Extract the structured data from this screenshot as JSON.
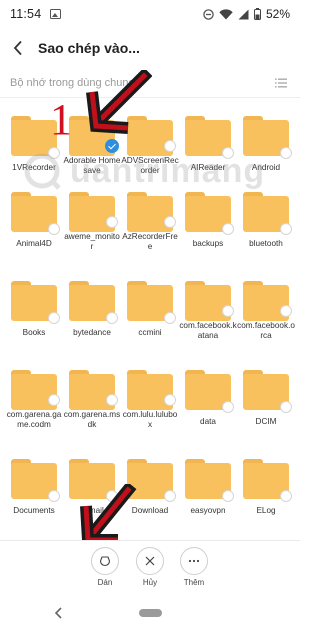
{
  "status_bar": {
    "time": "11:54",
    "battery": "52%"
  },
  "app_bar": {
    "title": "Sao chép vào..."
  },
  "path_bar": {
    "path": "Bộ nhớ trong dùng chung"
  },
  "folders": [
    {
      "name": "1VRecorder",
      "checked": false
    },
    {
      "name": "Adorable Home save",
      "checked": true
    },
    {
      "name": "ADVScreenRecorder",
      "checked": false
    },
    {
      "name": "AIReader",
      "checked": false
    },
    {
      "name": "Android",
      "checked": false
    },
    {
      "name": "Animal4D",
      "checked": false
    },
    {
      "name": "aweme_monitor",
      "checked": false
    },
    {
      "name": "AzRecorderFree",
      "checked": false
    },
    {
      "name": "backups",
      "checked": false
    },
    {
      "name": "bluetooth",
      "checked": false
    },
    {
      "name": "Books",
      "checked": false
    },
    {
      "name": "bytedance",
      "checked": false
    },
    {
      "name": "ccmini",
      "checked": false
    },
    {
      "name": "com.facebook.katana",
      "checked": false
    },
    {
      "name": "com.facebook.orca",
      "checked": false
    },
    {
      "name": "com.garena.game.codm",
      "checked": false
    },
    {
      "name": "com.garena.msdk",
      "checked": false
    },
    {
      "name": "com.lulu.lulubox",
      "checked": false
    },
    {
      "name": "data",
      "checked": false
    },
    {
      "name": "DCIM",
      "checked": false
    },
    {
      "name": "Documents",
      "checked": false
    },
    {
      "name": "dcmail",
      "checked": false
    },
    {
      "name": "Download",
      "checked": false
    },
    {
      "name": "easyovpn",
      "checked": false
    },
    {
      "name": "ELog",
      "checked": false
    }
  ],
  "annotations": {
    "step1": "1",
    "step2": "2",
    "color": "#d01020"
  },
  "watermark": {
    "text": "uantrimang"
  },
  "bottom_actions": [
    {
      "label": "Dán",
      "icon": "paste-icon"
    },
    {
      "label": "Hủy",
      "icon": "close-icon"
    },
    {
      "label": "Thêm",
      "icon": "more-icon"
    }
  ],
  "colors": {
    "folder": "#f8c15e",
    "check": "#2e8fe0"
  }
}
